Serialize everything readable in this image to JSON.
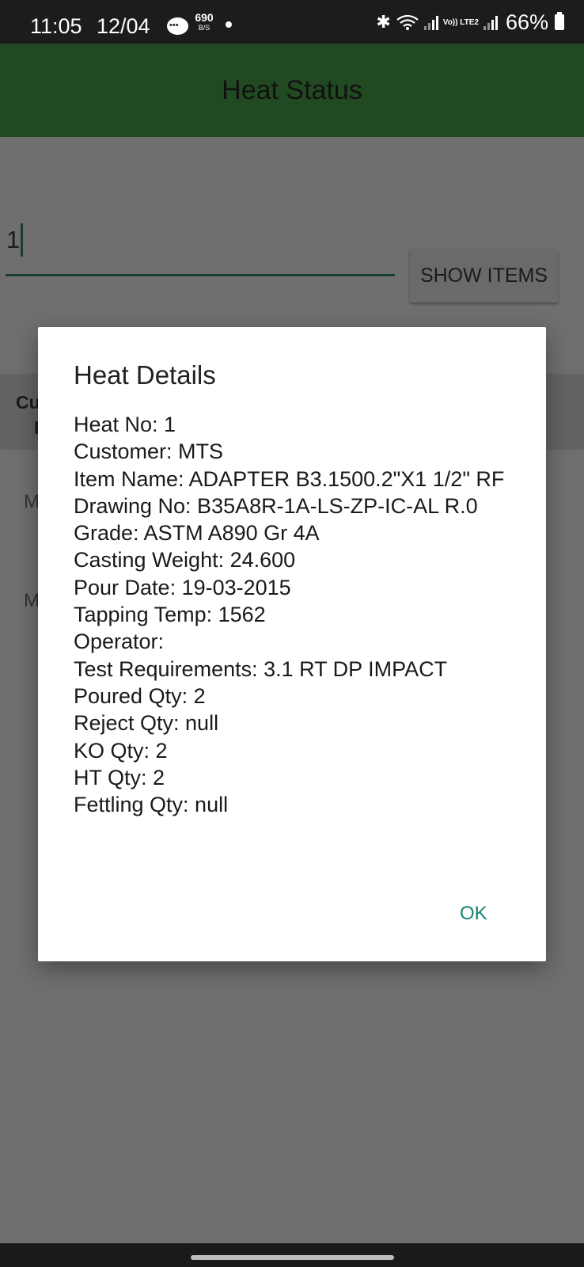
{
  "status_bar": {
    "time": "11:05",
    "date": "12/04",
    "net_speed_value": "690",
    "net_speed_unit": "B/S",
    "volte_label": "Vo)) LTE2",
    "battery": "66%"
  },
  "app_bar": {
    "title": "Heat Status"
  },
  "search": {
    "value": "1"
  },
  "show_items_button": {
    "label": "SHOW ITEMS"
  },
  "background_fragments": {
    "header_1": "Cu",
    "header_2": "I",
    "row_1": "M",
    "row_2": "M"
  },
  "dialog": {
    "title": "Heat Details",
    "details": [
      "Heat No: 1",
      "Customer: MTS",
      "Item Name: ADAPTER B3.1500.2\"X1 1/2\" RF",
      "Drawing No: B35A8R-1A-LS-ZP-IC-AL R.0",
      "Grade: ASTM A890 Gr 4A",
      "Casting Weight: 24.600",
      "Pour Date: 19-03-2015",
      "Tapping Temp: 1562",
      "Operator:",
      "Test Requirements: 3.1 RT DP IMPACT",
      "Poured Qty: 2",
      "Reject Qty: null",
      "KO Qty: 2",
      "HT Qty: 2",
      "Fettling Qty: null"
    ],
    "ok_label": "OK"
  },
  "colors": {
    "app_bar": "#214922",
    "scrim_background": "#6f6f6f",
    "accent": "#148474"
  }
}
